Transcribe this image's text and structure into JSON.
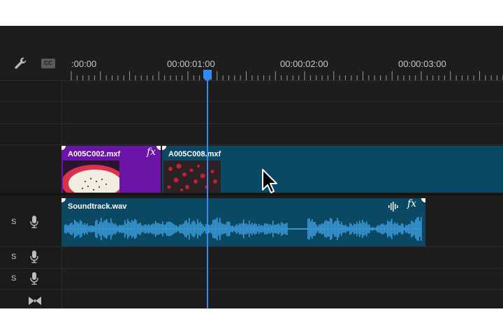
{
  "ruler": {
    "timecodes": [
      ":00:00",
      "00:00:01:00",
      "00:00:02:00",
      "00:00:03:00"
    ]
  },
  "header": {
    "captions_label": "CC"
  },
  "tracks": {
    "audio_solo_label": "S"
  },
  "video_clips": [
    {
      "name": "A005C002.mxf",
      "fx": "fx",
      "color": "#6a14a8"
    },
    {
      "name": "A005C008.mxf",
      "color": "#0b4864"
    }
  ],
  "audio_clip": {
    "name": "Soundtrack.wav",
    "fx": "fx",
    "color": "#0b4864",
    "waveform_color": "#3b9bd9"
  },
  "colors": {
    "playhead": "#2f8cff",
    "panel": "#1d1d1d"
  }
}
